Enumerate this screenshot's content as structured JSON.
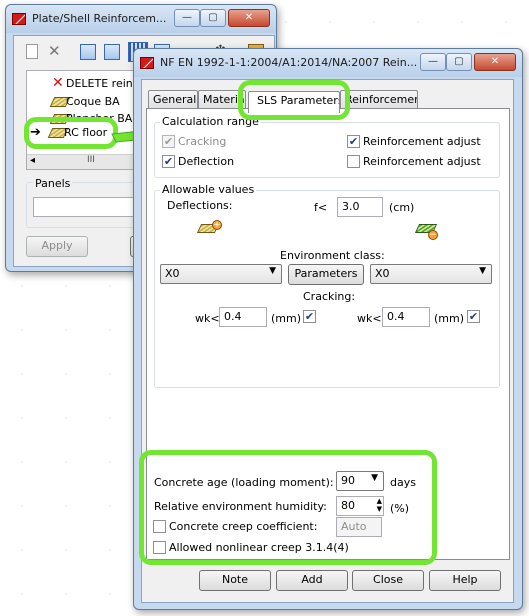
{
  "back_window": {
    "title": "Plate/Shell Reinforcem...",
    "titlebar_buttons": [
      "—",
      "▢",
      "✕"
    ],
    "tree_items": [
      {
        "label": "DELETE reinforc",
        "icon": "delete-x-icon"
      },
      {
        "label": "Coque BA",
        "icon": "slab-icon"
      },
      {
        "label": "Plancher BA",
        "icon": "slab-icon"
      },
      {
        "label": "RC floor",
        "icon": "slab-icon"
      }
    ],
    "hscroll": {
      "left": "◂",
      "thumb": "III",
      "right": "▸"
    },
    "panels_label": "Panels",
    "panels_value": "",
    "apply_label": "Apply",
    "close_label": "C"
  },
  "main_window": {
    "title": "NF EN 1992-1-1:2004/A1:2014/NA:2007 Rein...",
    "titlebar_buttons": [
      "—",
      "▢",
      "✕"
    ],
    "tabs": [
      "General",
      "Materials",
      "SLS Parameters",
      "Reinforcement"
    ],
    "active_tab": "SLS Parameters",
    "calc_range": {
      "title": "Calculation range",
      "cracking": {
        "label": "Cracking",
        "checked": true,
        "enabled": false
      },
      "deflection": {
        "label": "Deflection",
        "checked": true,
        "enabled": true
      },
      "reinf_adjust_1": {
        "label": "Reinforcement adjust",
        "checked": true
      },
      "reinf_adjust_2": {
        "label": "Reinforcement adjust",
        "checked": false
      }
    },
    "allowable": {
      "title": "Allowable values",
      "deflections_label": "Deflections:",
      "f_label": "f<",
      "f_value": "3.0",
      "f_unit": "(cm)",
      "env_class_label": "Environment class:",
      "env_left": "X0",
      "env_right": "X0",
      "parameters_label": "Parameters",
      "cracking_label": "Cracking:",
      "wk_label": "wk<",
      "wk_left_value": "0.4",
      "wk_right_value": "0.4",
      "wk_unit": "(mm)",
      "wk_left_checked": true,
      "wk_right_checked": true
    },
    "concrete": {
      "age_label": "Concrete age (loading moment):",
      "age_value": "90",
      "age_unit": "days",
      "humidity_label": "Relative environment humidity:",
      "humidity_value": "80",
      "humidity_unit": "(%)",
      "creep_label": "Concrete creep coefficient:",
      "creep_value": "Auto",
      "creep_checked": false,
      "nonlinear_label": "Allowed nonlinear creep 3.1.4(4)",
      "nonlinear_checked": false
    },
    "buttons": {
      "note": "Note",
      "add": "Add",
      "close": "Close",
      "help": "Help"
    }
  },
  "colors": {
    "highlight": "#73e634",
    "window_frame": "#c6d9ef",
    "dialog_bg": "#f0f0f0"
  }
}
